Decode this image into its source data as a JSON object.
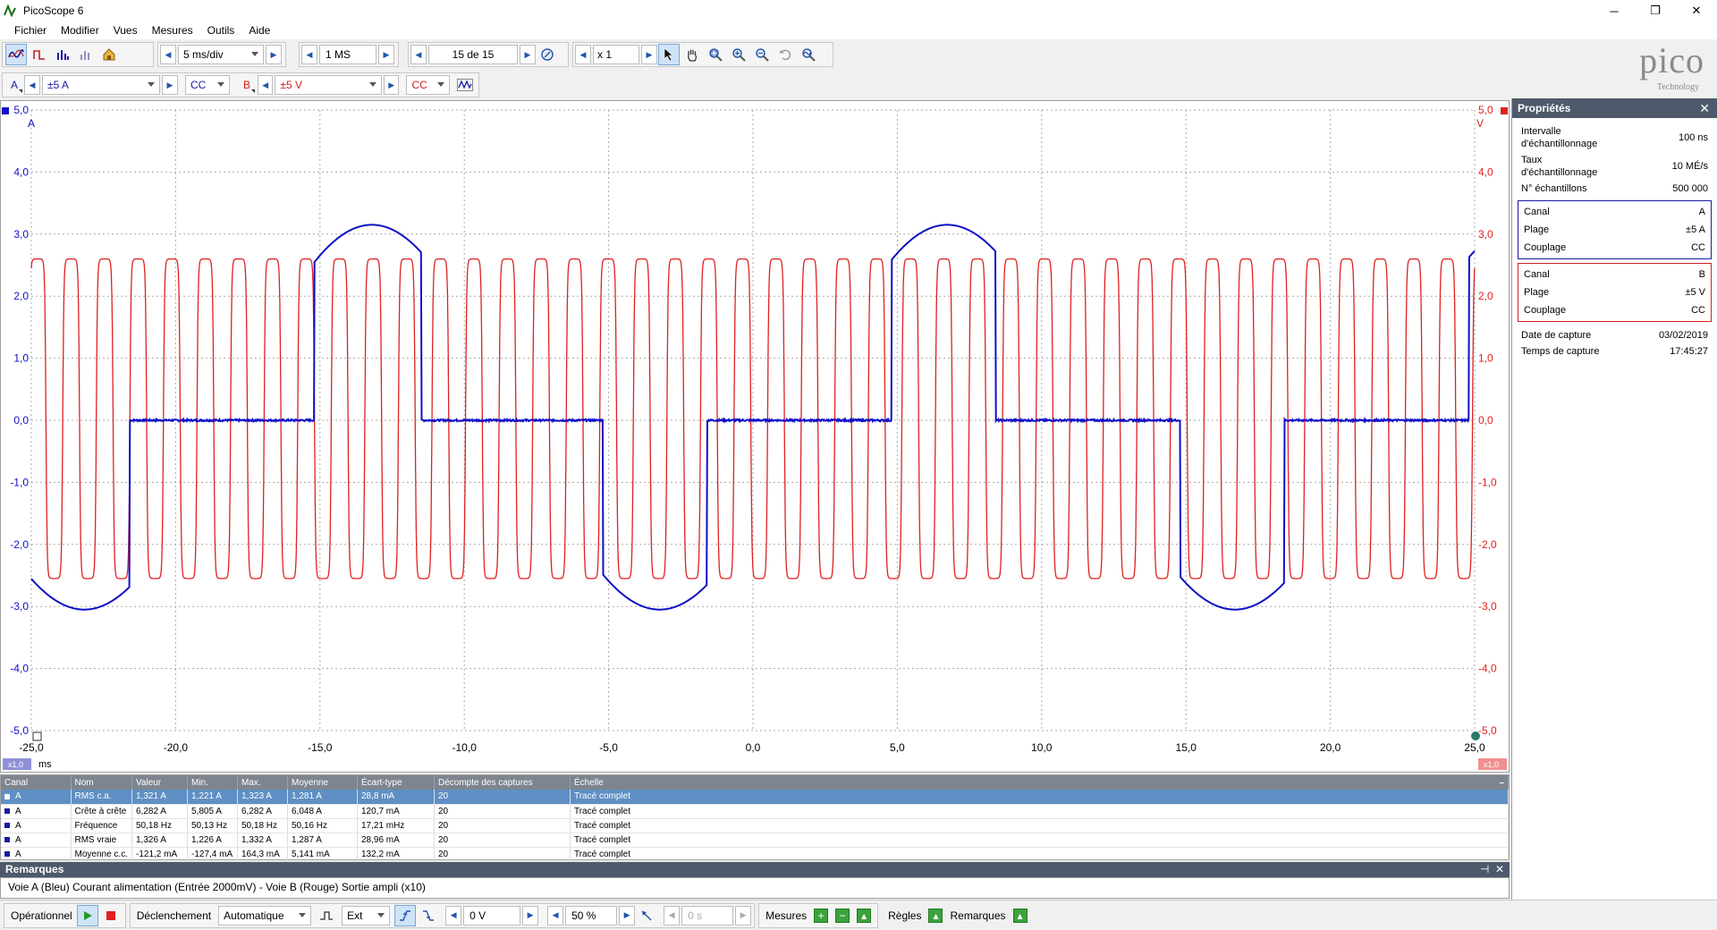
{
  "window": {
    "title": "PicoScope 6",
    "minimize": "─",
    "maximize": "❐",
    "close": "✕"
  },
  "menu": [
    "Fichier",
    "Modifier",
    "Vues",
    "Mesures",
    "Outils",
    "Aide"
  ],
  "toolbar": {
    "timebase": "5 ms/div",
    "samples": "1 MS",
    "capture_counter": "15 de 15",
    "zoom": "x 1"
  },
  "channel_toolbar": {
    "chan_a_label": "A",
    "chan_a_range": "±5 A",
    "chan_a_coupling": "CC",
    "chan_b_label": "B",
    "chan_b_range": "±5 V",
    "chan_b_coupling": "CC"
  },
  "logo": {
    "word": "pico",
    "sub": "Technology"
  },
  "scope": {
    "left_unit": "A",
    "right_unit": "V",
    "x_unit": "ms",
    "left_zoom": "x1,0",
    "right_zoom": "x1,0"
  },
  "chart_data": {
    "type": "line",
    "xlabel": "ms",
    "xlim": [
      -25,
      25
    ],
    "x_ticks": [
      "-25,0",
      "-20,0",
      "-15,0",
      "-10,0",
      "-5,0",
      "0,0",
      "5,0",
      "10,0",
      "15,0",
      "20,0",
      "25,0"
    ],
    "y_left_ticks": [
      "5,0",
      "4,0",
      "3,0",
      "2,0",
      "1,0",
      "0,0",
      "-1,0",
      "-2,0",
      "-3,0",
      "-4,0",
      "-5,0"
    ],
    "y_right_ticks": [
      "5,0",
      "4,0",
      "3,0",
      "2,0",
      "1,0",
      "0,0",
      "-1,0",
      "-2,0",
      "-3,0",
      "-4,0",
      "-5,0"
    ],
    "ylim": [
      -5,
      5
    ],
    "grid": true,
    "series": [
      {
        "name": "A",
        "color": "#1010c8",
        "shape": "pulsed sine",
        "peak": 3.15,
        "trough": -3.05,
        "period_ms": 19.93,
        "flat_level": 0.0,
        "pulse_windows_ms": [
          [
            -25,
            -21.6
          ],
          [
            -15.2,
            -11.5
          ],
          [
            -5.2,
            -1.6
          ],
          [
            4.8,
            8.4
          ],
          [
            14.8,
            18.4
          ],
          [
            24.8,
            25
          ]
        ],
        "peaks_ms": [
          -13.2,
          6.8
        ],
        "troughs_ms": [
          -23.0,
          -3.1,
          16.9
        ]
      },
      {
        "name": "B",
        "color": "#e02020",
        "shape": "square-ish oscillation",
        "high": 2.6,
        "low": -2.55,
        "cycles_in_window": 43
      }
    ]
  },
  "measurements": {
    "headers": [
      "Canal",
      "Nom",
      "Valeur",
      "Min.",
      "Max.",
      "Moyenne",
      "Écart-type",
      "Décompte des captures",
      "Échelle"
    ],
    "rows": [
      [
        "A",
        "RMS c.a.",
        "1,321 A",
        "1,221 A",
        "1,323 A",
        "1,281 A",
        "28,8 mA",
        "20",
        "Tracé complet"
      ],
      [
        "A",
        "Crête à crête",
        "6,282 A",
        "5,805 A",
        "6,282 A",
        "6,048 A",
        "120,7 mA",
        "20",
        "Tracé complet"
      ],
      [
        "A",
        "Fréquence",
        "50,18 Hz",
        "50,13 Hz",
        "50,18 Hz",
        "50,16 Hz",
        "17,21 mHz",
        "20",
        "Tracé complet"
      ],
      [
        "A",
        "RMS vraie",
        "1,326 A",
        "1,226 A",
        "1,332 A",
        "1,287 A",
        "28,96 mA",
        "20",
        "Tracé complet"
      ],
      [
        "A",
        "Moyenne c.c.",
        "-121,2 mA",
        "-127,4 mA",
        "164,3 mA",
        "5,141 mA",
        "132,2 mA",
        "20",
        "Tracé complet"
      ]
    ],
    "collapse": "–"
  },
  "remarks": {
    "title": "Remarques",
    "pin": "⊣",
    "close": "✕",
    "text": "Voie A (Bleu) Courant alimentation (Entrée 2000mV) - Voie B (Rouge) Sortie ampli (x10)"
  },
  "statusbar": {
    "mode": "Opérationnel",
    "trigger_label": "Déclenchement",
    "trigger_mode": "Automatique",
    "trigger_source": "Ext",
    "threshold": "0 V",
    "pretrigger": "50 %",
    "delay": "0 s",
    "measures_label": "Mesures",
    "rules_label": "Règles",
    "notes_label": "Remarques",
    "plus": "+",
    "minus": "−",
    "edit": "▴"
  },
  "properties": {
    "title": "Propriétés",
    "close": "✕",
    "general": [
      {
        "k": "Intervalle d'échantillonnage",
        "v": "100 ns"
      },
      {
        "k": "Taux d'échantillonnage",
        "v": "10 MÉ/s"
      },
      {
        "k": "N° échantillons",
        "v": "500 000"
      }
    ],
    "channel_a": [
      {
        "k": "Canal",
        "v": "A"
      },
      {
        "k": "Plage",
        "v": "±5 A"
      },
      {
        "k": "Couplage",
        "v": "CC"
      }
    ],
    "channel_b": [
      {
        "k": "Canal",
        "v": "B"
      },
      {
        "k": "Plage",
        "v": "±5 V"
      },
      {
        "k": "Couplage",
        "v": "CC"
      }
    ],
    "capture": [
      {
        "k": "Date de capture",
        "v": "03/02/2019"
      },
      {
        "k": "Temps de capture",
        "v": "17:45:27"
      }
    ]
  }
}
